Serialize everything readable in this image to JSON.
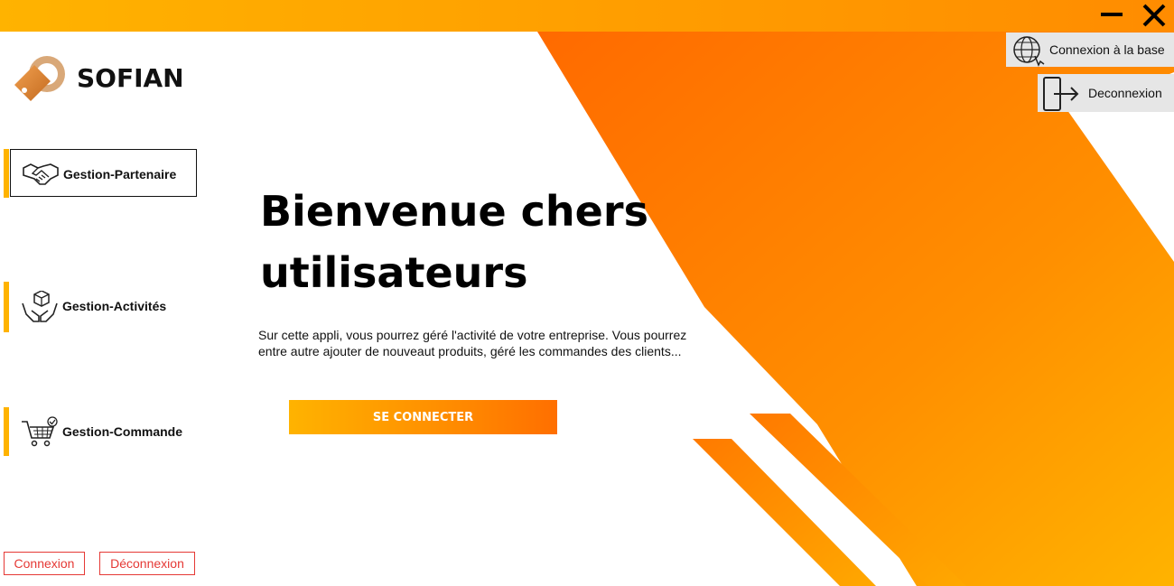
{
  "app": {
    "brand": "SOFIAN"
  },
  "window": {
    "minimize_icon": "minimize-icon",
    "close_icon": "close-icon"
  },
  "top_actions": {
    "connexion_base": "Connexion à la base",
    "deconnexion": "Deconnexion"
  },
  "sidebar": {
    "items": [
      {
        "label": "Gestion-Partenaire",
        "icon": "handshake-icon",
        "active": true
      },
      {
        "label": "Gestion-Activités",
        "icon": "box-hands-icon",
        "active": false
      },
      {
        "label": "Gestion-Commande",
        "icon": "shopping-cart-icon",
        "active": false
      }
    ]
  },
  "main": {
    "title_line1": "Bienvenue chers",
    "title_line2": "utilisateurs",
    "description": "Sur cette appli, vous pourrez géré l'activité de votre entreprise. Vous pourrez entre autre ajouter de nouveaut produits, géré les commandes des clients...",
    "connect_button": "SE CONNECTER"
  },
  "bottom": {
    "connexion": "Connexion",
    "deconnexion": "Déconnexion"
  },
  "colors": {
    "accent_yellow": "#ffb300",
    "accent_orange": "#ff6f00",
    "link_red": "#e53935"
  }
}
